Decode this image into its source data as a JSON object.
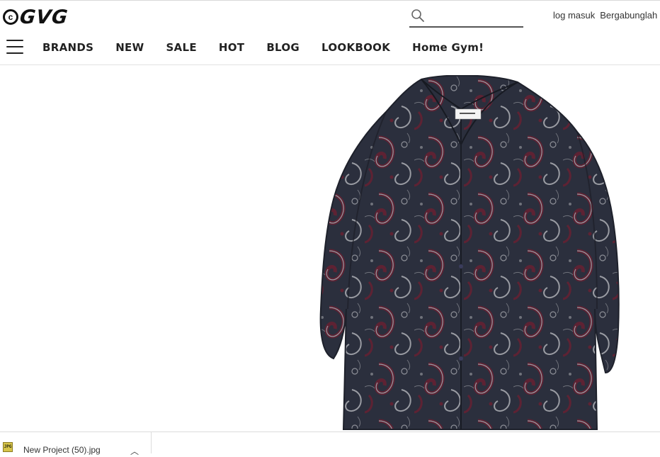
{
  "header": {
    "logo_text": "GVG",
    "search": {
      "placeholder": "",
      "value": ""
    },
    "login_label": "log masuk",
    "register_label": "Bergabunglah"
  },
  "nav": {
    "items": [
      {
        "label": "BRANDS"
      },
      {
        "label": "NEW"
      },
      {
        "label": "SALE"
      },
      {
        "label": "HOT"
      },
      {
        "label": "BLOG"
      },
      {
        "label": "LOOKBOOK"
      },
      {
        "label": "Home Gym!"
      }
    ]
  },
  "product": {
    "image_subject": "paisley-long-sleeve-shirt",
    "colors": {
      "base": "#2b2f3d",
      "paisley_red": "#5e2233",
      "paisley_grey": "#9a9ca3"
    }
  },
  "downloads": {
    "items": [
      {
        "file_name": "New Project (50).jpg",
        "file_type": "JPG"
      }
    ]
  },
  "colors": {
    "text": "#222222",
    "divider": "#e2e2e2"
  }
}
